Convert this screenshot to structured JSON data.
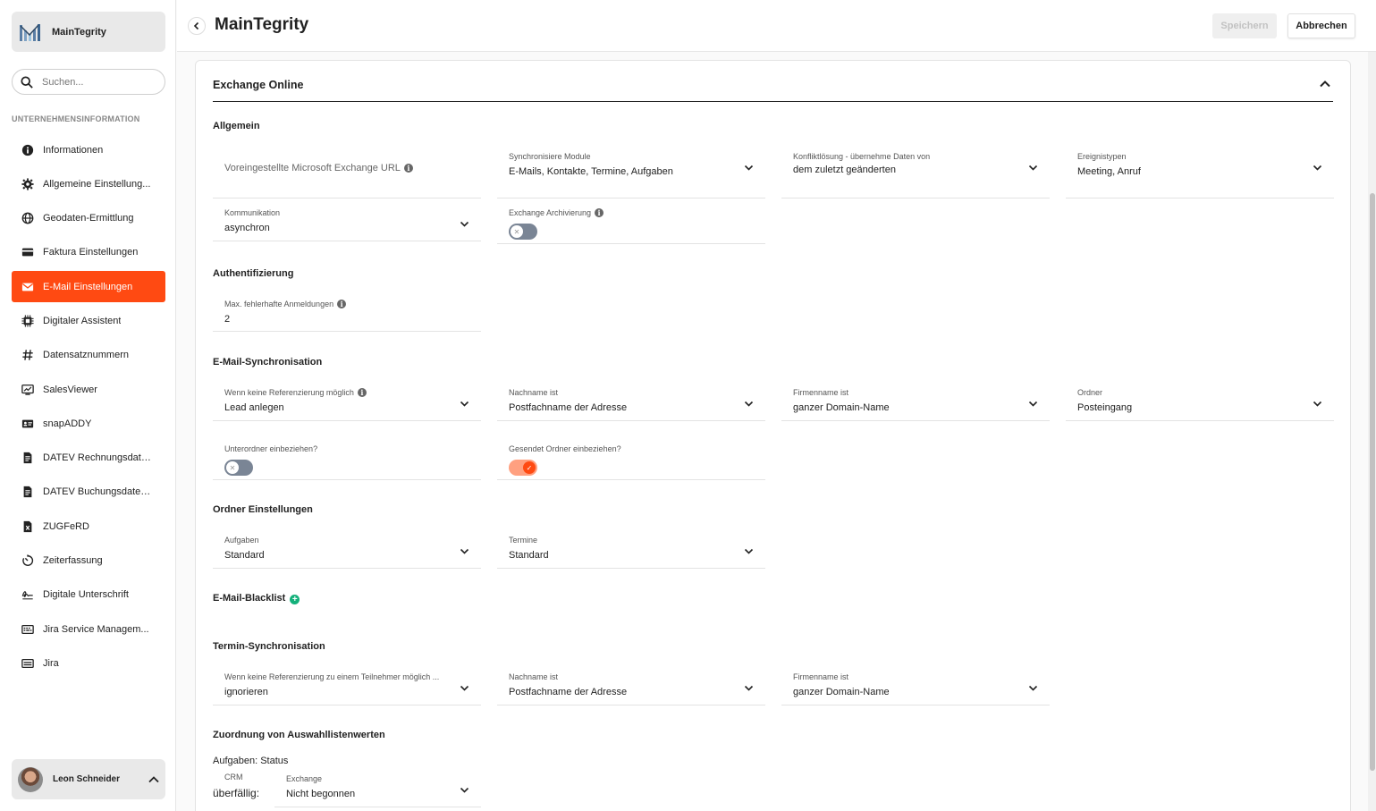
{
  "brand": {
    "name": "MainTegrity"
  },
  "search": {
    "placeholder": "Suchen..."
  },
  "sidebar": {
    "section_label": "UNTERNEHMENSINFORMATION",
    "items": [
      {
        "label": "Informationen",
        "icon": "info-icon"
      },
      {
        "label": "Allgemeine Einstellung...",
        "icon": "gear-icon"
      },
      {
        "label": "Geodaten-Ermittlung",
        "icon": "globe-icon"
      },
      {
        "label": "Faktura Einstellungen",
        "icon": "credit-card-icon"
      },
      {
        "label": "E-Mail Einstellungen",
        "icon": "envelope-icon",
        "active": true
      },
      {
        "label": "Digitaler Assistent",
        "icon": "chip-icon"
      },
      {
        "label": "Datensatznummern",
        "icon": "hash-icon"
      },
      {
        "label": "SalesViewer",
        "icon": "chart-monitor-icon"
      },
      {
        "label": "snapADDY",
        "icon": "contact-card-icon"
      },
      {
        "label": "DATEV Rechnungsdate...",
        "icon": "document-icon"
      },
      {
        "label": "DATEV Buchungsdaten...",
        "icon": "document-icon"
      },
      {
        "label": "ZUGFeRD",
        "icon": "xml-file-icon"
      },
      {
        "label": "Zeiterfassung",
        "icon": "timer-icon"
      },
      {
        "label": "Digitale Unterschrift",
        "icon": "signature-icon"
      },
      {
        "label": "Jira Service Managem...",
        "icon": "keyboard-icon"
      },
      {
        "label": "Jira",
        "icon": "server-icon"
      }
    ]
  },
  "user": {
    "name": "Leon Schneider"
  },
  "header": {
    "title": "MainTegrity",
    "save_label": "Speichern",
    "cancel_label": "Abbrechen"
  },
  "card": {
    "title": "Exchange Online",
    "allgemein": {
      "heading": "Allgemein",
      "url_placeholder": "Voreingestellte Microsoft Exchange URL",
      "sync_modules_label": "Synchronisiere Module",
      "sync_modules_value": "E-Mails, Kontakte, Termine, Aufgaben",
      "conflict_label": "Konfliktlösung - übernehme Daten von",
      "conflict_value": "dem zuletzt geänderten",
      "event_types_label": "Ereignistypen",
      "event_types_value": "Meeting, Anruf",
      "communication_label": "Kommunikation",
      "communication_value": "asynchron",
      "archiving_label": "Exchange Archivierung",
      "archiving_on": false
    },
    "auth": {
      "heading": "Authentifizierung",
      "max_failed_label": "Max. fehlerhafte Anmeldungen",
      "max_failed_value": "2"
    },
    "email_sync": {
      "heading": "E-Mail-Synchronisation",
      "no_ref_label": "Wenn keine Referenzierung möglich",
      "no_ref_value": "Lead anlegen",
      "lastname_label": "Nachname ist",
      "lastname_value": "Postfachname der Adresse",
      "company_label": "Firmenname ist",
      "company_value": "ganzer Domain-Name",
      "folder_label": "Ordner",
      "folder_value": "Posteingang",
      "subfolders_label": "Unterordner einbeziehen?",
      "subfolders_on": false,
      "sent_label": "Gesendet Ordner einbeziehen?",
      "sent_on": true
    },
    "folder_settings": {
      "heading": "Ordner Einstellungen",
      "tasks_label": "Aufgaben",
      "tasks_value": "Standard",
      "appointments_label": "Termine",
      "appointments_value": "Standard"
    },
    "blacklist": {
      "heading": "E-Mail-Blacklist"
    },
    "appointment_sync": {
      "heading": "Termin-Synchronisation",
      "no_ref_label": "Wenn keine Referenzierung zu einem Teilnehmer möglich ...",
      "no_ref_value": "ignorieren",
      "lastname_label": "Nachname ist",
      "lastname_value": "Postfachname der Adresse",
      "company_label": "Firmenname ist",
      "company_value": "ganzer Domain-Name"
    },
    "mapping": {
      "heading": "Zuordnung von Auswahllistenwerten",
      "subheading": "Aufgaben: Status",
      "crm_label": "CRM",
      "crm_value": "überfällig:",
      "exchange_label": "Exchange",
      "exchange_value": "Nicht begonnen"
    }
  },
  "colors": {
    "accent": "#ff4a12",
    "toggle_off": "#7a8595",
    "toggle_on_track": "#ffa080",
    "add": "#13b07a"
  }
}
